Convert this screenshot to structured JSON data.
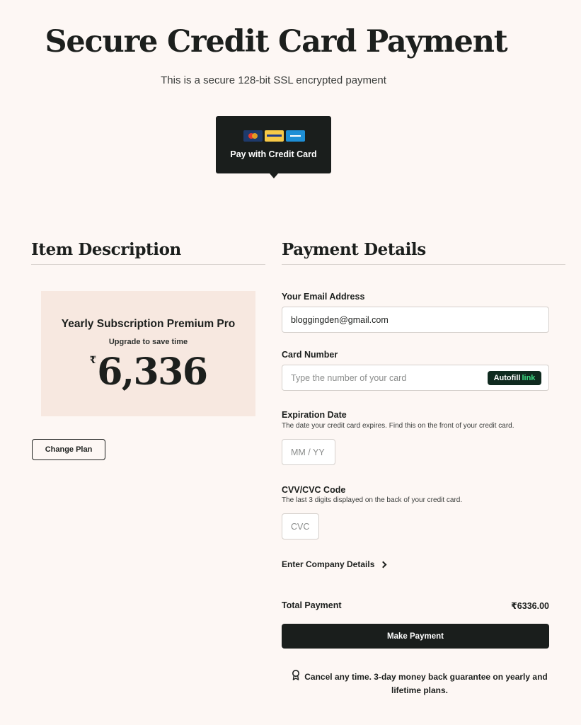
{
  "header": {
    "title": "Secure Credit Card Payment",
    "subtitle": "This is a secure 128-bit SSL encrypted payment"
  },
  "payment_method_tab": {
    "label": "Pay with Credit Card",
    "icons": [
      "mastercard-icon",
      "visa-icon",
      "amex-icon"
    ]
  },
  "item_description": {
    "heading": "Item Description",
    "plan_name": "Yearly Subscription Premium Pro",
    "plan_tagline": "Upgrade to save time",
    "currency_symbol": "₹",
    "price": "6,336",
    "change_plan_label": "Change Plan"
  },
  "payment_details": {
    "heading": "Payment Details",
    "email_label": "Your Email Address",
    "email_value": "bloggingden@gmail.com",
    "card_label": "Card Number",
    "card_placeholder": "Type the number of your card",
    "autofill_text": "Autofill",
    "autofill_link": "link",
    "expiry_label": "Expiration Date",
    "expiry_hint": "The date your credit card expires. Find this on the front of your credit card.",
    "expiry_placeholder": "MM / YY",
    "cvc_label": "CVV/CVC Code",
    "cvc_hint": "The last 3 digits displayed on the back of your credit card.",
    "cvc_placeholder": "CVC",
    "company_label": "Enter Company Details",
    "total_label": "Total Payment",
    "total_value": "₹6336.00",
    "submit_label": "Make Payment",
    "guarantee_text": "Cancel any time. 3-day money back guarantee on yearly and lifetime plans."
  },
  "colors": {
    "background": "#fdf7f4",
    "dark": "#1a1e1c",
    "card_bg": "#f7e8e0",
    "link_green": "#3ddc84"
  }
}
